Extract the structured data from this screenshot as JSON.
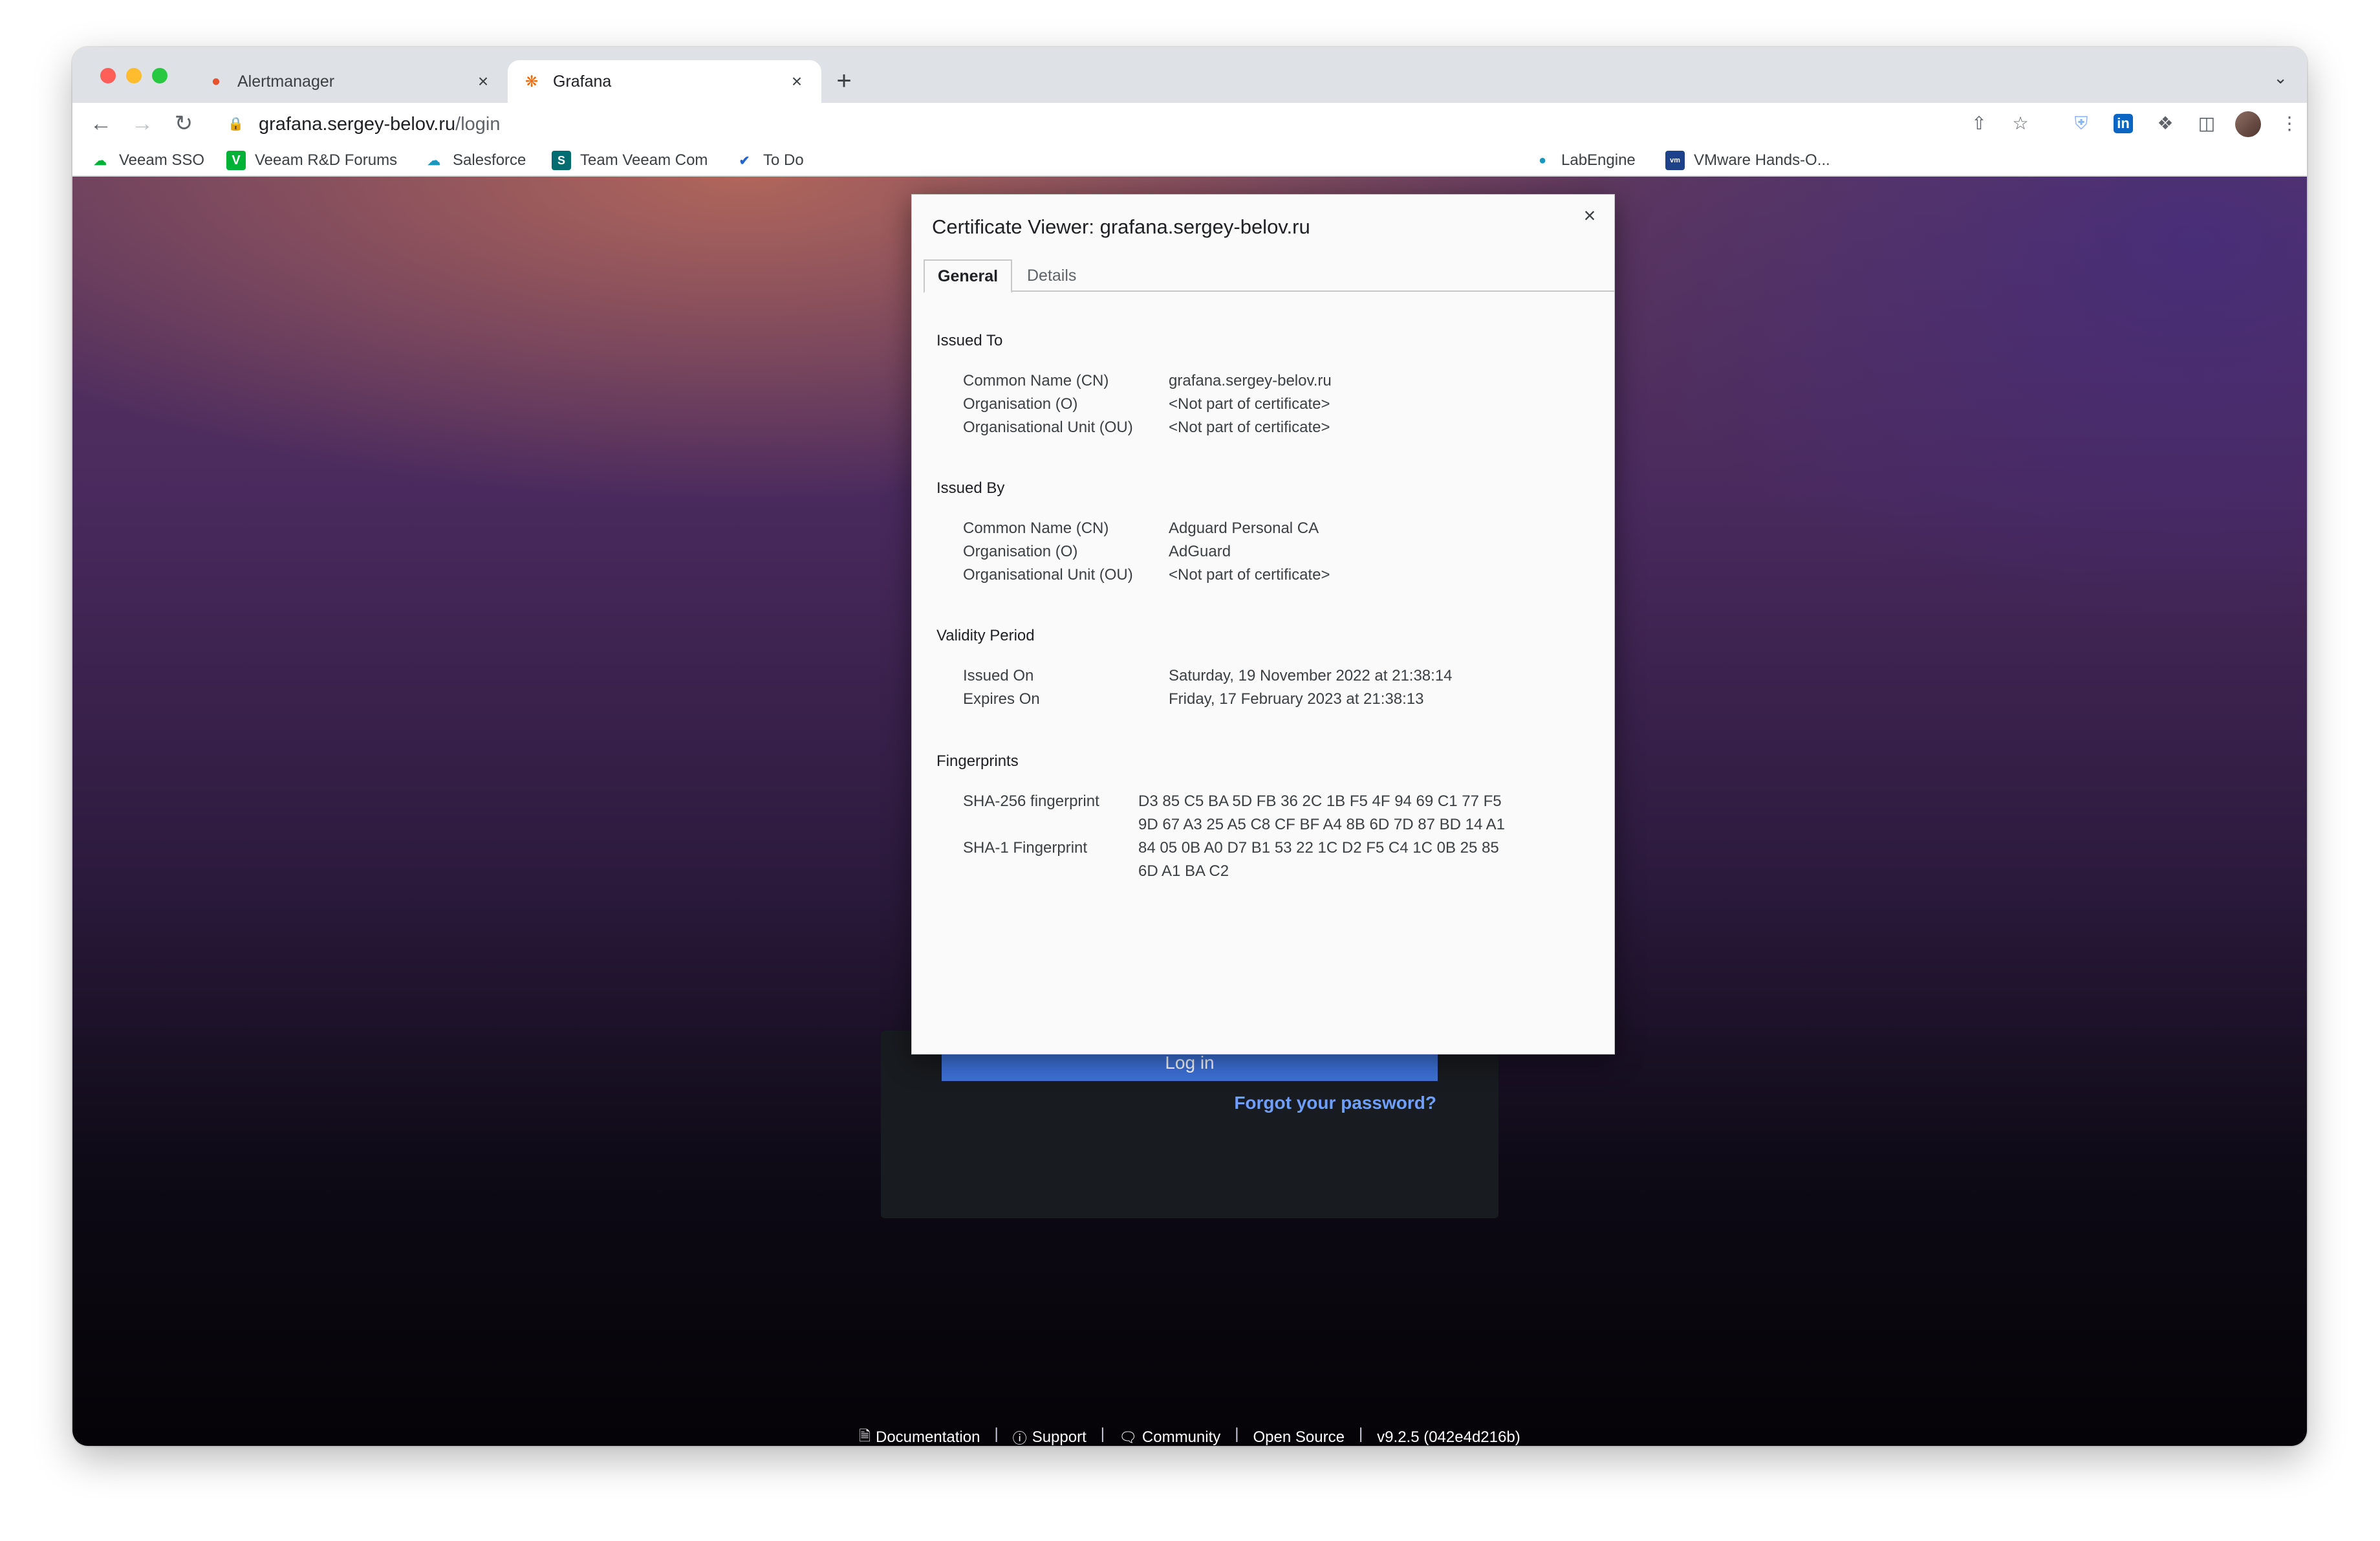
{
  "browser": {
    "tabs": [
      {
        "title": "Alertmanager",
        "icon": "alertmanager-icon"
      },
      {
        "title": "Grafana",
        "icon": "grafana-icon"
      }
    ],
    "new_tab": "+",
    "url": {
      "host": "grafana.sergey-belov.ru",
      "path": "/login"
    }
  },
  "bookmarks": [
    {
      "label": "Veeam SSO",
      "icon": "cloud-icon"
    },
    {
      "label": "Veeam R&D Forums",
      "icon": "veeam-v-icon"
    },
    {
      "label": "Salesforce",
      "icon": "salesforce-cloud-icon"
    },
    {
      "label": "Team Veeam Com",
      "icon": "sharepoint-icon"
    },
    {
      "label": "To Do",
      "icon": "checkmark-icon"
    },
    {
      "label": "LabEngine",
      "icon": "labengine-icon"
    },
    {
      "label": "VMware Hands-O...",
      "icon": "vmware-icon"
    }
  ],
  "page": {
    "login_button": "Log in",
    "forgot_password": "Forgot your password?",
    "footer": {
      "documentation": "Documentation",
      "support": "Support",
      "community": "Community",
      "open_source": "Open Source",
      "version": "v9.2.5 (042e4d216b)",
      "separator": "|"
    }
  },
  "certificate": {
    "title": "Certificate Viewer: grafana.sergey-belov.ru",
    "tabs": {
      "general": "General",
      "details": "Details"
    },
    "issued_to": {
      "heading": "Issued To",
      "cn_label": "Common Name (CN)",
      "cn": "grafana.sergey-belov.ru",
      "o_label": "Organisation (O)",
      "o": "<Not part of certificate>",
      "ou_label": "Organisational Unit (OU)",
      "ou": "<Not part of certificate>"
    },
    "issued_by": {
      "heading": "Issued By",
      "cn_label": "Common Name (CN)",
      "cn": "Adguard Personal CA",
      "o_label": "Organisation (O)",
      "o": "AdGuard",
      "ou_label": "Organisational Unit (OU)",
      "ou": "<Not part of certificate>"
    },
    "validity": {
      "heading": "Validity Period",
      "issued_label": "Issued On",
      "issued": "Saturday, 19 November 2022 at 21:38:14",
      "expires_label": "Expires On",
      "expires": "Friday, 17 February 2023 at 21:38:13"
    },
    "fingerprints": {
      "heading": "Fingerprints",
      "sha256_label": "SHA-256 fingerprint",
      "sha256_line1": "D3 85 C5 BA 5D FB 36 2C 1B F5 4F 94 69 C1 77 F5",
      "sha256_line2": "9D 67 A3 25 A5 C8 CF BF A4 8B 6D 7D 87 BD 14 A1",
      "sha1_label": "SHA-1 Fingerprint",
      "sha1_line1": "84 05 0B A0 D7 B1 53 22 1C D2 F5 C4 1C 0B 25 85",
      "sha1_line2": "6D A1 BA C2"
    }
  }
}
